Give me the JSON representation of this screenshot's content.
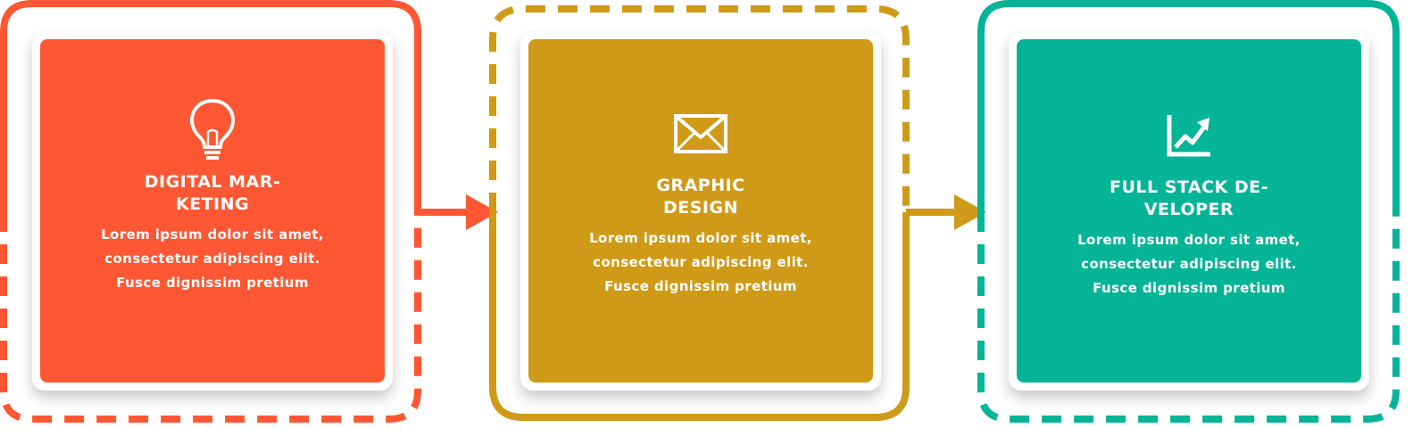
{
  "steps": [
    {
      "title": "DIGITAL MAR-\nKETING",
      "body": "Lorem ipsum dolor sit amet, consectetur adipiscing elit. Fusce dignissim pretium",
      "icon": "lightbulb-icon",
      "color": "#ff5733"
    },
    {
      "title": "GRAPHIC\nDESIGN",
      "body": "Lorem ipsum dolor sit amet, consectetur adipiscing elit. Fusce dignissim pretium",
      "icon": "envelope-icon",
      "color": "#cf9a17"
    },
    {
      "title": "FULL STACK DE-\nVELOPER",
      "body": "Lorem ipsum dolor sit amet, consectetur adipiscing elit. Fusce dignissim pretium",
      "icon": "growth-chart-icon",
      "color": "#03b497"
    }
  ]
}
